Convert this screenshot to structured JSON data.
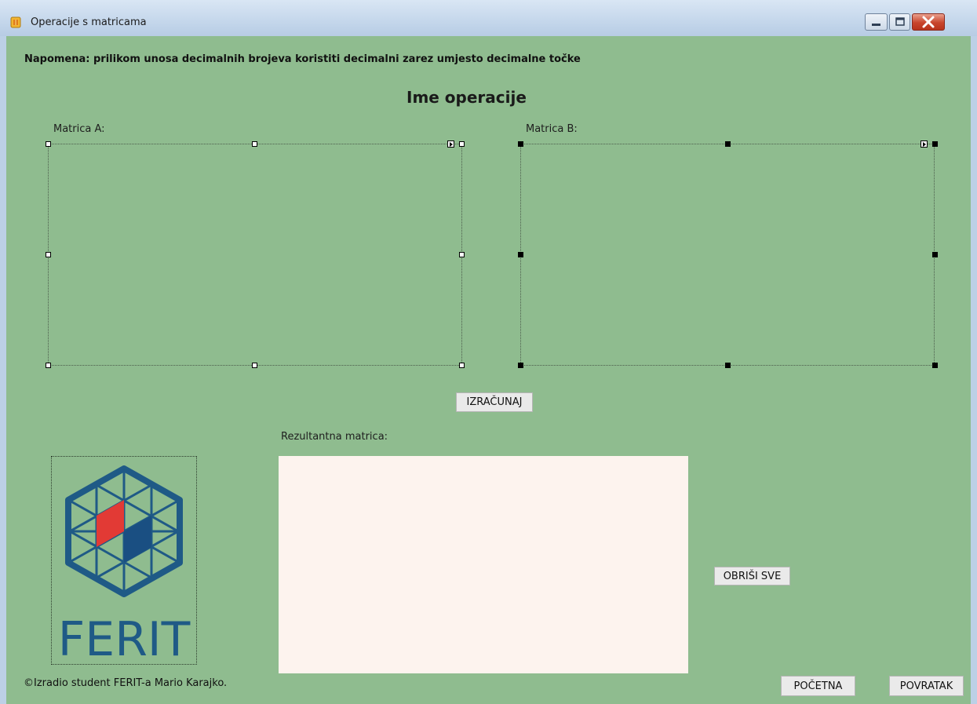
{
  "window": {
    "title": "Operacije s matricama",
    "icon": "app-icon",
    "controls": {
      "minimize": "minimize-icon",
      "maximize": "maximize-icon",
      "close": "close-icon"
    }
  },
  "form": {
    "note": "Napomena: prilikom unosa decimalnih brojeva koristiti decimalni zarez umjesto decimalne točke",
    "operation_title": "Ime operacije",
    "matrix_a_label": "Matrica A:",
    "matrix_b_label": "Matrica B:",
    "calculate_label": "IZRAČUNAJ",
    "result_label": "Rezultantna matrica:",
    "clear_all_label": "OBRIŠI SVE",
    "home_label": "POČETNA",
    "back_label": "POVRATAK",
    "footer": "©Izradio student FERIT-a Mario Karajko."
  },
  "logo": {
    "text": "FERIT",
    "hex_color": "#1f5a86",
    "red": "#e23a35",
    "blue": "#1a4f82"
  },
  "colors": {
    "form_background": "#8fbc8f",
    "result_background": "#fdf3ee",
    "titlebar": "#c6d8ec",
    "close_button": "#c8452c"
  }
}
